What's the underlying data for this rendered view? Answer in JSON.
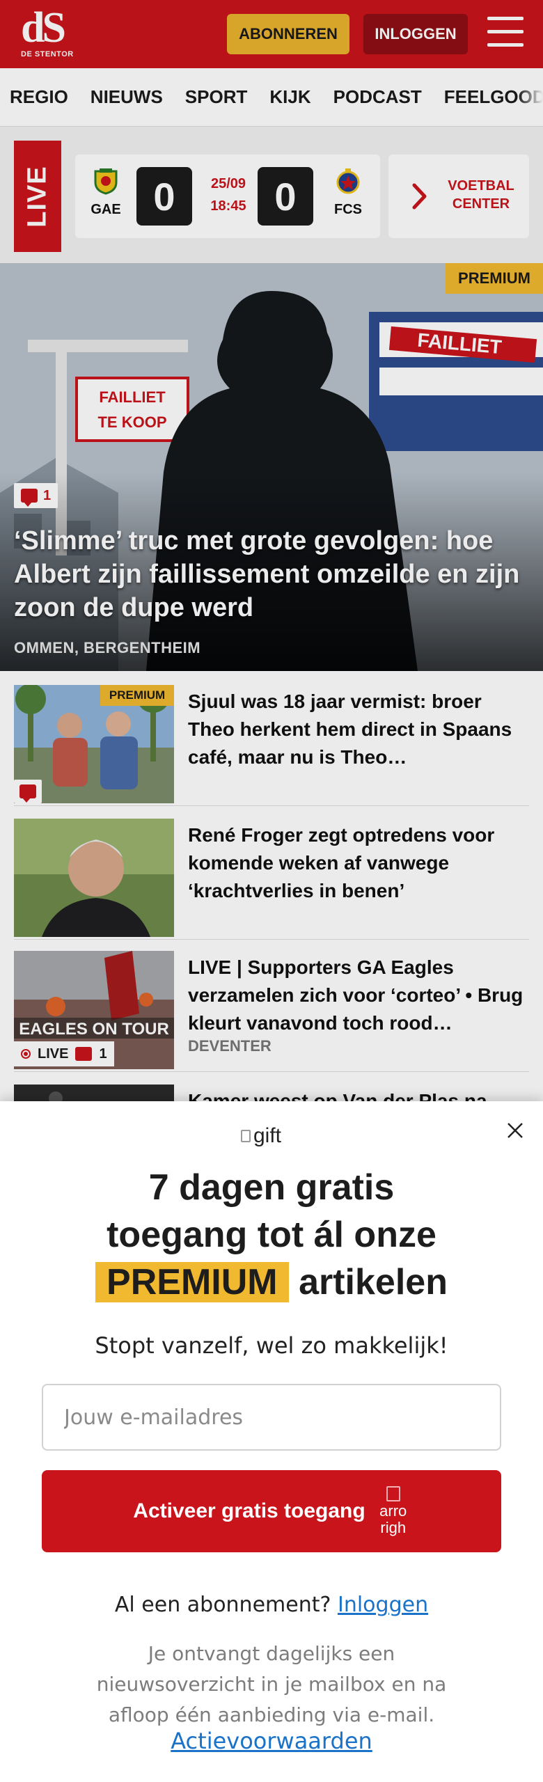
{
  "header": {
    "logo_mark": "dS",
    "logo_text": "DE STENTOR",
    "subscribe_label": "ABONNEREN",
    "login_label": "INLOGGEN",
    "brand_color": "#c9141b",
    "subscribe_color": "#e9b32e"
  },
  "nav": {
    "items": [
      "REGIO",
      "NIEUWS",
      "SPORT",
      "KIJK",
      "PODCAST",
      "FEELGOOD"
    ]
  },
  "live": {
    "tag": "LIVE",
    "home_team": "GAE",
    "away_team": "FCS",
    "home_score": "0",
    "away_score": "0",
    "date": "25/09",
    "time": "18:45",
    "center_label": "VOETBAL CENTER"
  },
  "hero": {
    "premium_label": "PREMIUM",
    "comments": "1",
    "title": "‘Slimme’ truc met grote gevolgen: hoe Albert zijn faillissement omzeilde en zijn zoon de dupe werd",
    "location": "OMMEN, BERGENTHEIM",
    "sign_left_top": "FAILLIET",
    "sign_left_bottom": "TE KOOP",
    "sign_right": "FAILLIET"
  },
  "articles": [
    {
      "premium_label": "PREMIUM",
      "title": "Sjuul was 18 jaar vermist: broer Theo herkent hem direct in Spaans café, maar nu is Theo…",
      "has_comment": true
    },
    {
      "title": "René Froger zegt optredens voor komende weken af vanwege ‘krachtverlies in benen’"
    },
    {
      "title": "LIVE | Supporters GA Eagles verzamelen zich voor ‘corteo’ • Brug kleurt vanavond toch rood…",
      "location": "DEVENTER",
      "live_label": "LIVE",
      "comments": "1",
      "banner_text": "EAGLES ON TOUR"
    },
    {
      "title": "Kamer weest op Van der Plas na"
    }
  ],
  "modal": {
    "gift_alt": "gift",
    "title_line1": "7 dagen gratis",
    "title_line2": "toegang tot ál onze",
    "title_highlight": "PREMIUM",
    "title_line3_rest": "artikelen",
    "subtitle": "Stopt vanzelf, wel zo makkelijk!",
    "email_placeholder": "Jouw e-mailadres",
    "cta_label": "Activeer gratis toegang",
    "cta_icon_alt_1": "arro",
    "cta_icon_alt_2": "righ",
    "have_subscription": "Al een abonnement?",
    "login_link": "Inloggen",
    "note": "Je ontvangt dagelijks een nieuwsoverzicht in je mailbox en na afloop één aanbieding via e-mail.",
    "terms_link": "Actievoorwaarden"
  }
}
